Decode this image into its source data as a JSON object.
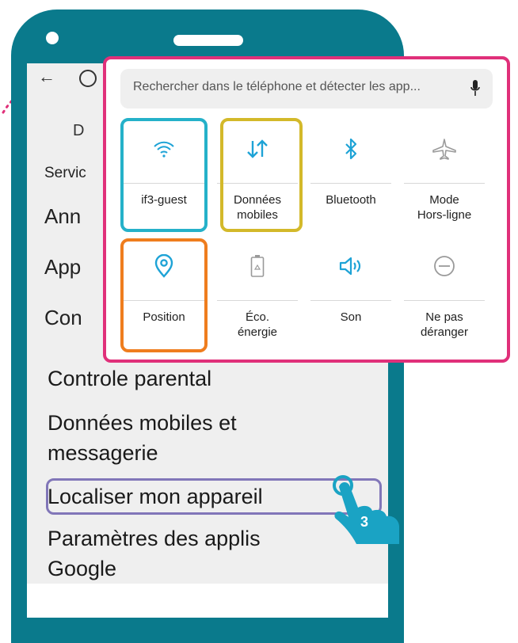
{
  "screen": {
    "header_fragment": "D",
    "section_fragment": "Servic",
    "partial_items": [
      "Ann",
      "App",
      "Con"
    ],
    "menu_items": [
      "Controle parental",
      "Données mobiles et",
      "messagerie",
      "Localiser mon appareil",
      "Paramètres des applis",
      "Google"
    ]
  },
  "quick_settings": {
    "search_placeholder": "Rechercher dans le téléphone et détecter les app...",
    "tiles": [
      {
        "icon": "wifi-icon",
        "line1": "if3-guest",
        "line2": ""
      },
      {
        "icon": "mobile-data-icon",
        "line1": "Données",
        "line2": "mobiles"
      },
      {
        "icon": "bluetooth-icon",
        "line1": "Bluetooth",
        "line2": ""
      },
      {
        "icon": "airplane-icon",
        "line1": "Mode",
        "line2": "Hors-ligne"
      },
      {
        "icon": "location-icon",
        "line1": "Position",
        "line2": ""
      },
      {
        "icon": "battery-saver-icon",
        "line1": "Éco.",
        "line2": "énergie"
      },
      {
        "icon": "sound-icon",
        "line1": "Son",
        "line2": ""
      },
      {
        "icon": "do-not-disturb-icon",
        "line1": "Ne pas",
        "line2": "déranger"
      }
    ]
  },
  "step_badge": "3",
  "colors": {
    "phone": "#0a7a8c",
    "overlay_border": "#e0307a",
    "wifi_frame": "#25b1c9",
    "data_frame": "#d3b92a",
    "position_frame": "#ef7d1e",
    "highlight_frame": "#8176b8",
    "active_icon": "#1ea3d6",
    "inactive_icon": "#9a9a9a",
    "hand": "#1aa3c4"
  }
}
